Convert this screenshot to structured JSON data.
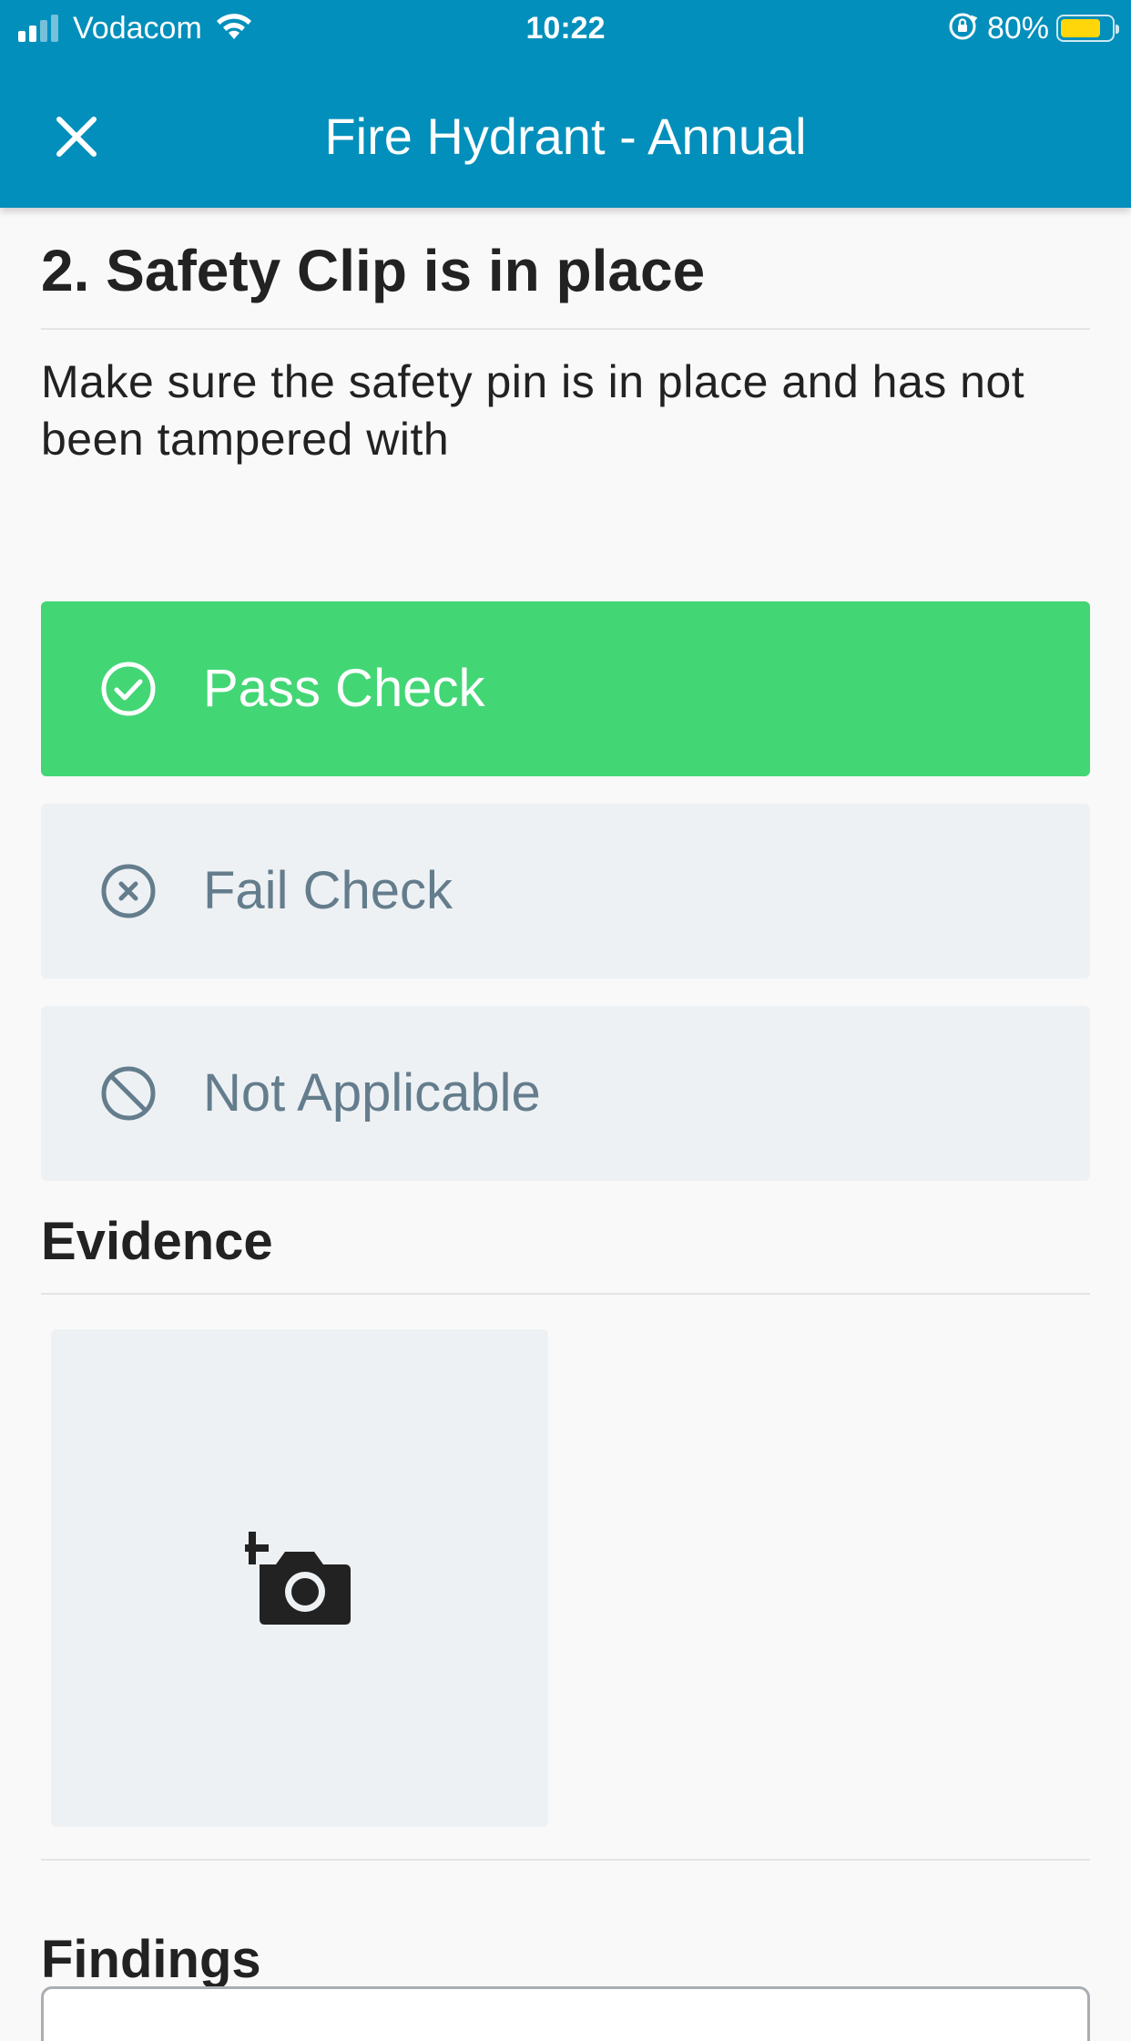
{
  "status_bar": {
    "carrier": "Vodacom",
    "time": "10:22",
    "battery_percent": "80%",
    "battery_level": 0.8,
    "signal_bars": 2,
    "signal_bars_total": 4
  },
  "header": {
    "title": "Fire Hydrant - Annual",
    "close_icon": "close-icon"
  },
  "question": {
    "title": "2. Safety Clip is in place",
    "description": "Make sure the safety pin is in place and has not been tampered with"
  },
  "options": [
    {
      "label": "Pass Check",
      "icon": "check-circle-icon",
      "selected": true
    },
    {
      "label": "Fail Check",
      "icon": "x-circle-icon",
      "selected": false
    },
    {
      "label": "Not Applicable",
      "icon": "block-icon",
      "selected": false
    }
  ],
  "evidence": {
    "title": "Evidence",
    "add_photo_icon": "add-photo-camera-icon"
  },
  "findings": {
    "title": "Findings",
    "value": ""
  },
  "colors": {
    "header_bg": "#028fbb",
    "pass_selected": "#43d675",
    "option_bg": "#eef1f4",
    "option_text": "#647d8d",
    "battery": "#ffd60a"
  }
}
